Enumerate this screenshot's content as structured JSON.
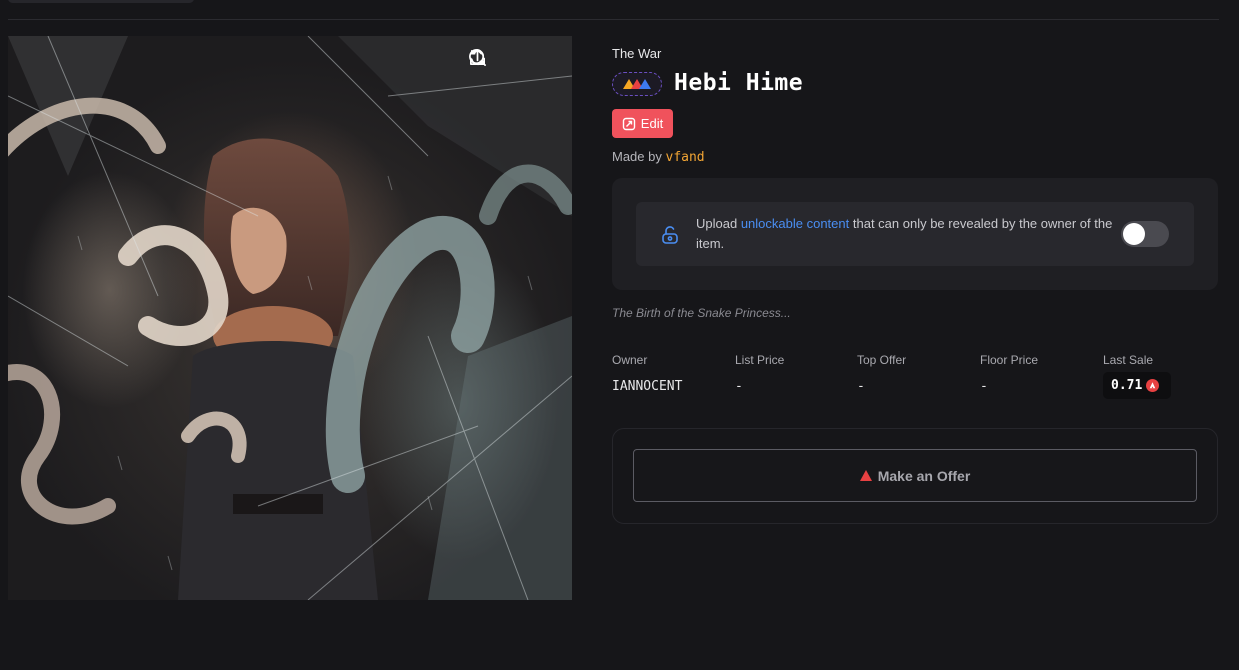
{
  "collection": {
    "name": "The War"
  },
  "item": {
    "title": "Hebi Hime",
    "edit_label": "Edit",
    "made_by_label": "Made by",
    "creator": "vfand",
    "description": "The Birth of the Snake Princess..."
  },
  "unlockable": {
    "prefix": "Upload",
    "link": "unlockable content",
    "suffix": "that can only be revealed by the owner of the item.",
    "toggle_on": false
  },
  "stats": [
    {
      "label": "Owner",
      "value": "IANNOCENT"
    },
    {
      "label": "List Price",
      "value": "-"
    },
    {
      "label": "Top Offer",
      "value": "-"
    },
    {
      "label": "Floor Price",
      "value": "-"
    },
    {
      "label": "Last Sale",
      "value": "0.71"
    }
  ],
  "offer": {
    "label": "Make an Offer"
  },
  "artwork_tools": [
    "refresh-icon",
    "search-icon",
    "share-icon"
  ],
  "colors": {
    "background": "#161619",
    "edit_button": "#f0525c",
    "creator": "#f2a534",
    "link": "#4a8ef2",
    "avax_red": "#e84142"
  }
}
